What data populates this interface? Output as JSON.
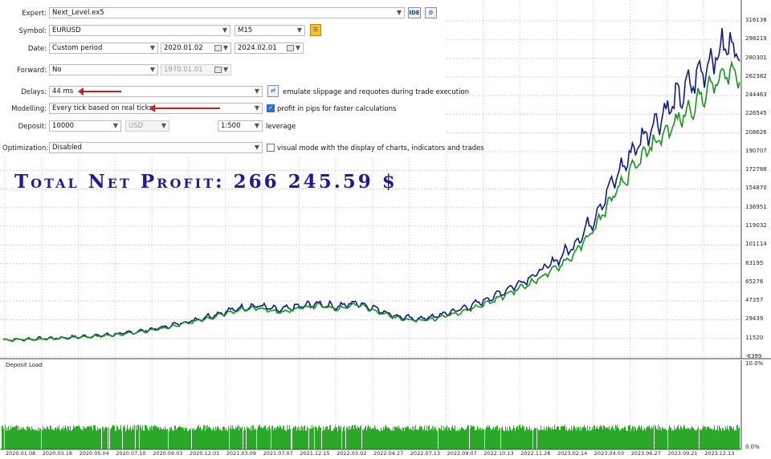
{
  "settings": {
    "expert": {
      "label": "Expert:",
      "value": "Next_Level.ex5",
      "ide_label": "IDE"
    },
    "symbol": {
      "label": "Symbol:",
      "value": "EURUSD",
      "timeframe": "M15"
    },
    "date": {
      "label": "Date:",
      "period": "Custom period",
      "from": "2020.01.02",
      "to": "2024.02.01"
    },
    "forward": {
      "label": "Forward:",
      "value": "No",
      "date": "1970.01.01"
    },
    "delays": {
      "label": "Delays:",
      "value": "44 ms",
      "option_label": "emulate slippage and requotes during trade execution"
    },
    "modelling": {
      "label": "Modelling:",
      "value": "Every tick based on real ticks",
      "option_label": "profit in pips for faster calculations",
      "option_checked": true
    },
    "deposit": {
      "label": "Deposit:",
      "value": "10000",
      "currency": "USD",
      "leverage_value": "1:500",
      "leverage_label": "leverage"
    },
    "optimization": {
      "label": "Optimization:",
      "value": "Disabled",
      "option_label": "visual mode with the display of charts, indicators and trades",
      "option_checked": false
    }
  },
  "headline": "Total Net Profit:   266 245.59 $",
  "colors": {
    "balance": "#15961a",
    "equity": "#0e1a8a",
    "load": "#2aa827",
    "headline": "#1e1aa0",
    "arrow": "#d21a1a"
  },
  "chart_data": [
    {
      "type": "line",
      "title": "",
      "y_ticks": [
        "316138",
        "298219",
        "280301",
        "262382",
        "244463",
        "226545",
        "208626",
        "190707",
        "172788",
        "154870",
        "136951",
        "119032",
        "101114",
        "83195",
        "65276",
        "47357",
        "29439",
        "11520",
        "-6399"
      ],
      "ylim": [
        -6399,
        316138
      ],
      "x_ticks": [
        "2020.01.08",
        "2020.03.18",
        "2020.05.04",
        "2020.07.10",
        "2020.09.03",
        "2020.12.01",
        "2021.03.09",
        "2021.07.07",
        "2021.12.15",
        "2022.03.02",
        "2022.04.27",
        "2022.07.13",
        "2022.09.07",
        "2022.10.13",
        "2022.11.28",
        "2023.02.14",
        "2023.04.03",
        "2023.06.27",
        "2023.09.21",
        "2023.12.13"
      ],
      "series": [
        {
          "name": "",
          "color": "#0e1a8a",
          "points": [
            [
              0,
              10000
            ],
            [
              2,
              10600
            ],
            [
              4,
              11300
            ],
            [
              6,
              12000
            ],
            [
              8,
              13200
            ],
            [
              10,
              14400
            ],
            [
              12,
              16000
            ],
            [
              14,
              18500
            ],
            [
              16,
              21500
            ],
            [
              18,
              26000
            ],
            [
              20,
              30500
            ],
            [
              22,
              35500
            ],
            [
              24,
              40500
            ],
            [
              26,
              43000
            ],
            [
              28,
              38500
            ],
            [
              30,
              42000
            ],
            [
              32,
              45000
            ],
            [
              34,
              42000
            ],
            [
              36,
              46000
            ],
            [
              38,
              40000
            ],
            [
              40,
              33000
            ],
            [
              42,
              30000
            ],
            [
              44,
              32500
            ],
            [
              46,
              38000
            ],
            [
              48,
              44000
            ],
            [
              50,
              52000
            ],
            [
              52,
              62000
            ],
            [
              54,
              72000
            ],
            [
              56,
              84000
            ],
            [
              58,
              100000
            ],
            [
              60,
              125000
            ],
            [
              62,
              160000
            ],
            [
              64,
              190000
            ],
            [
              66,
              215000
            ],
            [
              68,
              235000
            ],
            [
              70,
              255000
            ],
            [
              72,
              278000
            ],
            [
              74,
              296000
            ],
            [
              75,
              282000
            ]
          ]
        },
        {
          "name": "",
          "color": "#15961a",
          "points": [
            [
              0,
              10000
            ],
            [
              2,
              10400
            ],
            [
              4,
              11000
            ],
            [
              6,
              11700
            ],
            [
              8,
              12800
            ],
            [
              10,
              14000
            ],
            [
              12,
              15500
            ],
            [
              14,
              17800
            ],
            [
              16,
              20600
            ],
            [
              18,
              24800
            ],
            [
              20,
              29000
            ],
            [
              22,
              33800
            ],
            [
              24,
              38500
            ],
            [
              26,
              41000
            ],
            [
              28,
              36500
            ],
            [
              30,
              40000
            ],
            [
              32,
              43000
            ],
            [
              34,
              40000
            ],
            [
              36,
              44000
            ],
            [
              38,
              38000
            ],
            [
              40,
              31000
            ],
            [
              42,
              28500
            ],
            [
              44,
              30500
            ],
            [
              46,
              35500
            ],
            [
              48,
              41000
            ],
            [
              50,
              48000
            ],
            [
              52,
              57000
            ],
            [
              54,
              66000
            ],
            [
              56,
              77000
            ],
            [
              58,
              91000
            ],
            [
              60,
              114000
            ],
            [
              62,
              146000
            ],
            [
              64,
              172000
            ],
            [
              66,
              196000
            ],
            [
              68,
              214000
            ],
            [
              70,
              232000
            ],
            [
              72,
              252000
            ],
            [
              74,
              268000
            ],
            [
              75,
              262000
            ]
          ]
        }
      ]
    },
    {
      "type": "bar",
      "title": "Deposit Load",
      "ylim": [
        0,
        10
      ],
      "y_ticks": [
        "10.0%",
        "0.0%"
      ],
      "level_percent": 2.4
    }
  ]
}
